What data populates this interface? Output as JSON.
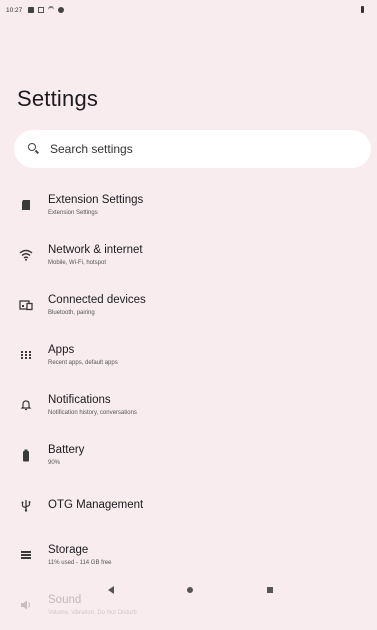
{
  "status": {
    "time": "10:27",
    "notification_icons": [
      "square-notification-icon",
      "grid-notification-icon",
      "wifi-notification-icon",
      "gear-notification-icon"
    ]
  },
  "page": {
    "title": "Settings"
  },
  "search": {
    "placeholder": "Search settings"
  },
  "items": [
    {
      "icon": "sd-card-icon",
      "title": "Extension Settings",
      "summary": "Extension Settings"
    },
    {
      "icon": "wifi-icon",
      "title": "Network & internet",
      "summary": "Mobile, Wi-Fi, hotspot"
    },
    {
      "icon": "connected-devices-icon",
      "title": "Connected devices",
      "summary": "Bluetooth, pairing"
    },
    {
      "icon": "apps-grid-icon",
      "title": "Apps",
      "summary": "Recent apps, default apps"
    },
    {
      "icon": "bell-icon",
      "title": "Notifications",
      "summary": "Notification history, conversations"
    },
    {
      "icon": "battery-icon",
      "title": "Battery",
      "summary": "90%"
    },
    {
      "icon": "usb-icon",
      "title": "OTG Management",
      "summary": ""
    },
    {
      "icon": "storage-icon",
      "title": "Storage",
      "summary": "11% used - 114 GB free"
    },
    {
      "icon": "volume-icon",
      "title": "Sound",
      "summary": "Volume, vibration, Do Not Disturb"
    }
  ],
  "navigation": {
    "back": "back-icon",
    "home": "home-icon",
    "recents": "recents-icon"
  }
}
